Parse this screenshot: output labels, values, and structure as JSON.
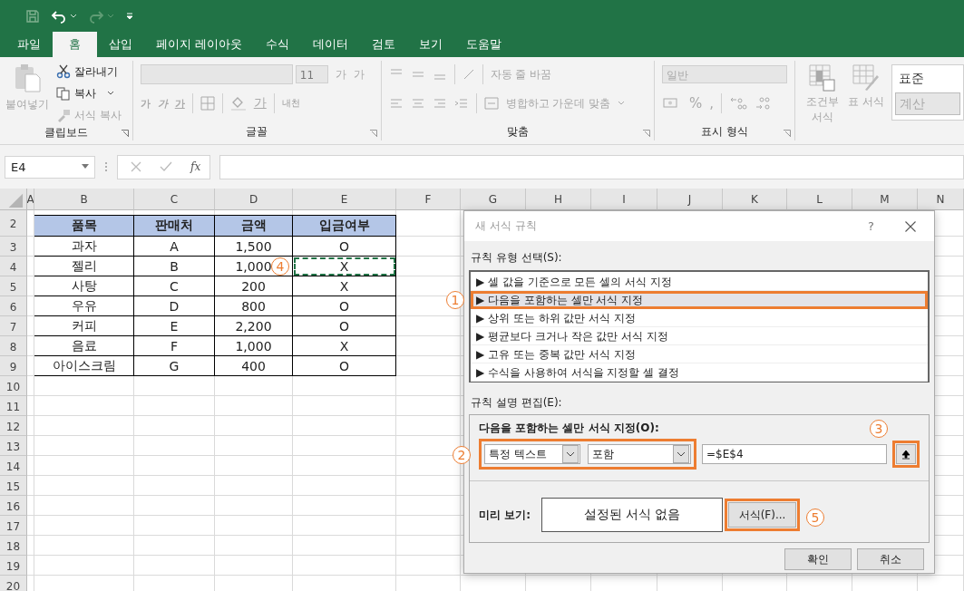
{
  "tabs": [
    {
      "label": "파일",
      "selected": false
    },
    {
      "label": "홈",
      "selected": true
    },
    {
      "label": "삽입",
      "selected": false
    },
    {
      "label": "페이지 레이아웃",
      "selected": false
    },
    {
      "label": "수식",
      "selected": false
    },
    {
      "label": "데이터",
      "selected": false
    },
    {
      "label": "검토",
      "selected": false
    },
    {
      "label": "보기",
      "selected": false
    },
    {
      "label": "도움말",
      "selected": false
    }
  ],
  "ribbon": {
    "clipboard": {
      "label": "클립보드",
      "paste": {
        "label": "붙여넣기",
        "disabled": true
      },
      "items": [
        {
          "label": "잘라내기",
          "disabled": false
        },
        {
          "label": "복사",
          "disabled": false
        },
        {
          "label": "서식 복사",
          "disabled": true
        }
      ]
    },
    "font": {
      "label": "글꼴",
      "size": "11",
      "size_buttons": [
        "가",
        "가"
      ],
      "style_buttons": [
        "가",
        "가",
        "가"
      ],
      "font_color": "가",
      "phonetic": "내천"
    },
    "alignment": {
      "label": "맞춤",
      "wrap": "자동 줄 바꿈",
      "merge": "병합하고 가운데 맞춤"
    },
    "number": {
      "label": "표시 형식",
      "format": "일반",
      "percent": "%",
      "comma": ","
    },
    "styles": {
      "conditional": "조건부 서식",
      "table": "표 서식",
      "gallery": [
        "표준",
        "계산"
      ]
    }
  },
  "formula_bar": {
    "name_box": "E4",
    "fx": "fx"
  },
  "sheet": {
    "columns": [
      "A",
      "B",
      "C",
      "D",
      "E",
      "F",
      "G",
      "H",
      "I",
      "J",
      "K",
      "L",
      "M",
      "N"
    ],
    "rows": [
      {
        "num": "2",
        "header": true,
        "cells": [
          {
            "text": "품목",
            "marquee": false
          },
          {
            "text": "판매처",
            "marquee": false
          },
          {
            "text": "금액",
            "marquee": false
          },
          {
            "text": "입금여부",
            "marquee": false
          }
        ]
      },
      {
        "num": "3",
        "header": false,
        "cells": [
          {
            "text": "과자",
            "marquee": false
          },
          {
            "text": "A",
            "marquee": false
          },
          {
            "text": "1,500",
            "marquee": false
          },
          {
            "text": "O",
            "marquee": false
          }
        ]
      },
      {
        "num": "4",
        "header": false,
        "cells": [
          {
            "text": "젤리",
            "marquee": false
          },
          {
            "text": "B",
            "marquee": false
          },
          {
            "text": "1,000",
            "marquee": false
          },
          {
            "text": "X",
            "marquee": true,
            "callout": "4"
          }
        ]
      },
      {
        "num": "5",
        "header": false,
        "cells": [
          {
            "text": "사탕",
            "marquee": false
          },
          {
            "text": "C",
            "marquee": false
          },
          {
            "text": "200",
            "marquee": false
          },
          {
            "text": "X",
            "marquee": false
          }
        ]
      },
      {
        "num": "6",
        "header": false,
        "cells": [
          {
            "text": "우유",
            "marquee": false
          },
          {
            "text": "D",
            "marquee": false
          },
          {
            "text": "800",
            "marquee": false
          },
          {
            "text": "O",
            "marquee": false
          }
        ]
      },
      {
        "num": "7",
        "header": false,
        "cells": [
          {
            "text": "커피",
            "marquee": false
          },
          {
            "text": "E",
            "marquee": false
          },
          {
            "text": "2,200",
            "marquee": false
          },
          {
            "text": "O",
            "marquee": false
          }
        ]
      },
      {
        "num": "8",
        "header": false,
        "cells": [
          {
            "text": "음료",
            "marquee": false
          },
          {
            "text": "F",
            "marquee": false
          },
          {
            "text": "1,000",
            "marquee": false
          },
          {
            "text": "X",
            "marquee": false
          }
        ]
      },
      {
        "num": "9",
        "header": false,
        "cells": [
          {
            "text": "아이스크림",
            "marquee": false
          },
          {
            "text": "G",
            "marquee": false
          },
          {
            "text": "400",
            "marquee": false
          },
          {
            "text": "O",
            "marquee": false
          }
        ]
      },
      {
        "num": "10"
      },
      {
        "num": "11"
      },
      {
        "num": "12"
      },
      {
        "num": "13"
      },
      {
        "num": "14"
      },
      {
        "num": "15"
      },
      {
        "num": "16"
      },
      {
        "num": "17"
      },
      {
        "num": "18"
      },
      {
        "num": "19"
      },
      {
        "num": "20"
      }
    ]
  },
  "dialog": {
    "title": "새 서식 규칙",
    "help": "?",
    "rule_type_label": "규칙 유형 선택(S):",
    "rule_types": [
      {
        "label": "▶ 셀 값을 기준으로 모든 셀의 서식 지정",
        "selected": false
      },
      {
        "label": "▶ 다음을 포함하는 셀만 서식 지정",
        "selected": true,
        "callout": "1"
      },
      {
        "label": "▶ 상위 또는 하위 값만 서식 지정",
        "selected": false
      },
      {
        "label": "▶ 평균보다 크거나 작은 값만 서식 지정",
        "selected": false
      },
      {
        "label": "▶ 고유 또는 중복 값만 서식 지정",
        "selected": false
      },
      {
        "label": "▶ 수식을 사용하여 서식을 지정할 셀 결정",
        "selected": false
      }
    ],
    "edit_label": "규칙 설명 편집(E):",
    "edit_heading": "다음을 포함하는 셀만 서식 지정(O):",
    "conditions": {
      "callout": "2",
      "dropdowns": [
        {
          "value": "특정 텍스트"
        },
        {
          "value": "포함"
        }
      ]
    },
    "value_field": {
      "value": "=$E$4"
    },
    "collapse_button": {
      "callout": "3"
    },
    "preview_label": "미리 보기:",
    "preview_text": "설정된 서식 없음",
    "format_button": {
      "label": "서식(F)...",
      "callout": "5"
    },
    "buttons": [
      "확인",
      "취소"
    ]
  }
}
